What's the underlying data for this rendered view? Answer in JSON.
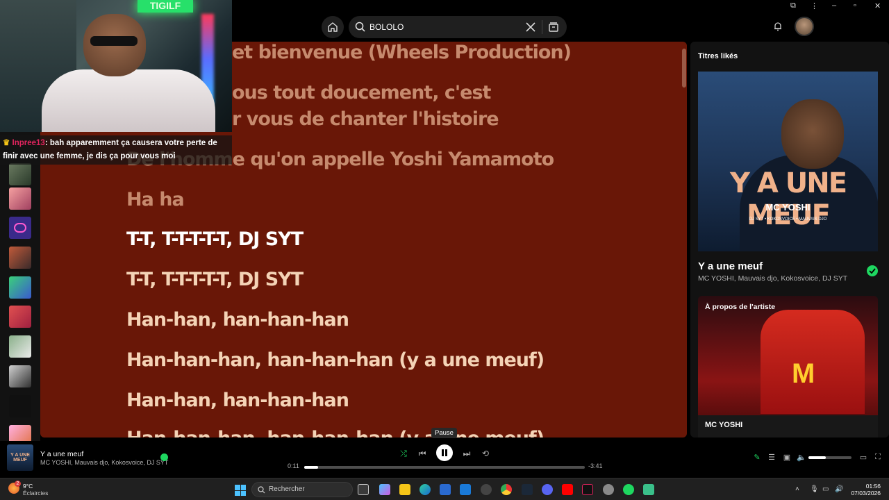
{
  "topbar": {
    "search_value": "BOLOLO"
  },
  "stream": {
    "neon_text": "TIGILF",
    "chat": {
      "username": "Inpree13",
      "message": ": bah apparemment ça causera votre perte de finir avec une femme, je dis ça pour vous moi"
    }
  },
  "lyrics": {
    "lines": [
      {
        "text": "et bienvenue (Wheels Production)",
        "state": "past"
      },
      {
        "text": "ous tout doucement, c'est",
        "state": "past"
      },
      {
        "text": "r vous de chanter l'histoire",
        "state": "past"
      },
      {
        "text": "De l'homme qu'on appelle Yoshi Yamamoto",
        "state": "past"
      },
      {
        "text": "Ha ha",
        "state": "past"
      },
      {
        "text": "T-T, T-T-T-T-T, DJ SYT",
        "state": "current"
      },
      {
        "text": "T-T, T-T-T-T-T, DJ SYT",
        "state": "future"
      },
      {
        "text": "Han-han, han-han-han",
        "state": "future"
      },
      {
        "text": "Han-han-han, han-han-han (y a une meuf)",
        "state": "future"
      },
      {
        "text": "Han-han, han-han-han",
        "state": "future"
      },
      {
        "text": "Han-han-han, han-han-han (y a une meuf)",
        "state": "future"
      }
    ]
  },
  "right_panel": {
    "title": "Titres likés",
    "cover": {
      "title": "Y A UNE MEUF",
      "artist": "MC YOSHI",
      "feat": "DJ SYT • KOKOSVOICE • MAUVAIS DJO"
    },
    "song_title": "Y a une meuf",
    "song_artists": "MC YOSHI, Mauvais djo, Kokosvoice, DJ SYT",
    "about_label": "À propos de l'artiste",
    "about_artist": "MC YOSHI"
  },
  "player": {
    "title": "Y a une meuf",
    "artists": "MC YOSHI, Mauvais djo, Kokosvoice, DJ SYT",
    "cover_text": "Y A UNE MEUF",
    "tooltip": "Pause",
    "elapsed": "0:11",
    "remaining": "-3:41",
    "progress": 0.05,
    "volume": 0.4
  },
  "taskbar": {
    "weather_temp": "9°C",
    "weather_desc": "Éclaircies",
    "weather_badge": "2",
    "search_placeholder": "Rechercher",
    "time": "01:56",
    "date": "07/03/2026"
  },
  "colors": {
    "lyrics_bg": "#691707",
    "accent": "#1ed760",
    "past_line": "#c68a6e",
    "current_line": "#ffffff",
    "future_line": "#f4d3b6"
  }
}
